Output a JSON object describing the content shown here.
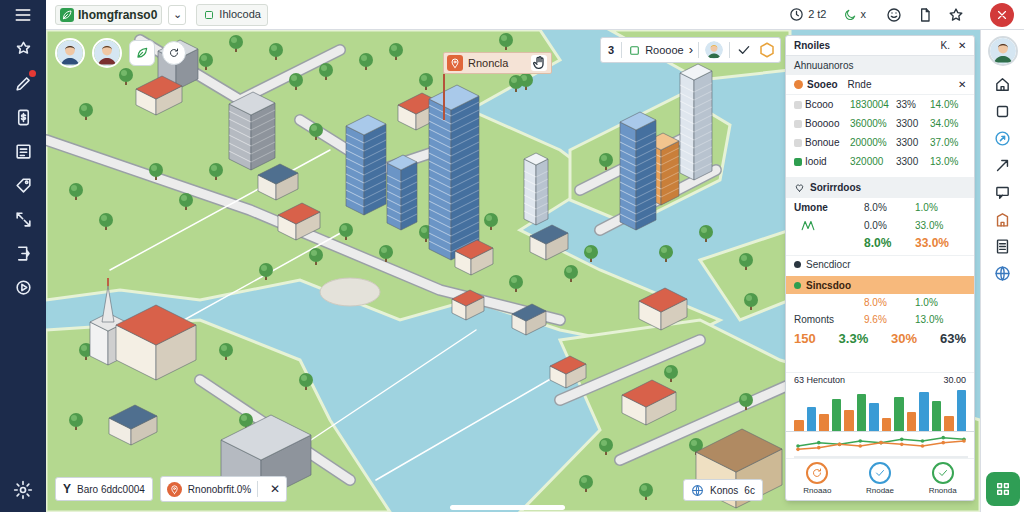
{
  "app": {
    "logo": "Ihomgfranso0",
    "dropdown": "⌄",
    "workspace": "Ihlocoda"
  },
  "topbar": {
    "time": "2 t2",
    "mode": "x"
  },
  "sidebar": {
    "items": [
      {
        "badge": false
      },
      {
        "badge": true
      },
      {
        "badge": false
      },
      {
        "badge": false
      },
      {
        "badge": false
      },
      {
        "badge": false
      },
      {
        "badge": false
      },
      {
        "badge": false
      }
    ]
  },
  "map": {
    "flag": {
      "label": "Rnoncla"
    },
    "filter": {
      "count": "3",
      "label": "Rooooe",
      "chevron": "›"
    },
    "status_chips": [
      {
        "icon": "Y",
        "label": "Baro 6ddc0004"
      },
      {
        "label": "Rnonobrfit.0%",
        "close": "✕"
      }
    ],
    "corner_chip": {
      "label": "Konos",
      "value": "6c"
    }
  },
  "panel": {
    "title": "Rnoiles",
    "shortcut": "K.",
    "close": "✕",
    "section": "Ahnuuanoros",
    "search": {
      "label": "Sooeo",
      "value": "Rnde",
      "clear": "✕"
    },
    "rows": [
      {
        "name": "Bcooo",
        "v1": "1830004",
        "v2": "33%",
        "v3": "14.0%",
        "color": "#d9d9d9"
      },
      {
        "name": "Booooo",
        "v1": "36000%",
        "v2": "3300",
        "v3": "34.0%",
        "color": "#d9d9d9"
      },
      {
        "name": "Bonoue",
        "v1": "20000%",
        "v2": "3300",
        "v3": "37.0%",
        "color": "#d9d9d9"
      },
      {
        "name": "Iooid",
        "v1": "320000",
        "v2": "3300",
        "v3": "13.0%",
        "color": "#2e9e4f"
      }
    ],
    "summary": {
      "title": "Sorirrdoos",
      "label": "Umone",
      "rows": [
        [
          "8.0%",
          "1.0%"
        ],
        [
          "0.0%",
          "33.0%"
        ],
        [
          "8.0%",
          "33.0%"
        ]
      ]
    },
    "groups": [
      {
        "label": "Sencdiocr",
        "selected": false
      },
      {
        "label": "Sincsdoo",
        "selected": true
      }
    ],
    "group_rows": [
      {
        "a": "8.0%",
        "b": "1.0%"
      },
      {
        "label": "Romonts",
        "a": "9.6%",
        "b": "13.0%"
      }
    ],
    "totals": [
      "150",
      "3.3%",
      "30%",
      "63%"
    ],
    "chart": {
      "title": "63 Hencuton",
      "value": "30.00",
      "bars": [
        {
          "value": 10,
          "color": "#e8833a"
        },
        {
          "value": 22,
          "color": "#3a9bd5"
        },
        {
          "value": 16,
          "color": "#e8833a"
        },
        {
          "value": 30,
          "color": "#3aa655"
        },
        {
          "value": 20,
          "color": "#e8833a"
        },
        {
          "value": 34,
          "color": "#3aa655"
        },
        {
          "value": 26,
          "color": "#3a9bd5"
        },
        {
          "value": 12,
          "color": "#e8833a"
        },
        {
          "value": 32,
          "color": "#3aa655"
        },
        {
          "value": 18,
          "color": "#e8833a"
        },
        {
          "value": 36,
          "color": "#3a9bd5"
        },
        {
          "value": 28,
          "color": "#3aa655"
        },
        {
          "value": 14,
          "color": "#e8833a"
        },
        {
          "value": 38,
          "color": "#3a9bd5"
        }
      ],
      "lines": [
        {
          "color": "#3aa655",
          "values": [
            6,
            8,
            7,
            9,
            8,
            10,
            9,
            11,
            10
          ]
        },
        {
          "color": "#e8833a",
          "values": [
            4,
            5,
            7,
            6,
            8,
            7,
            6,
            8,
            9
          ]
        }
      ]
    },
    "actions": [
      {
        "label": "Rnoaao",
        "color": "#e8833a"
      },
      {
        "label": "Rnodae",
        "color": "#3a9bd5"
      },
      {
        "label": "Rnonda",
        "color": "#3aa655"
      }
    ]
  }
}
